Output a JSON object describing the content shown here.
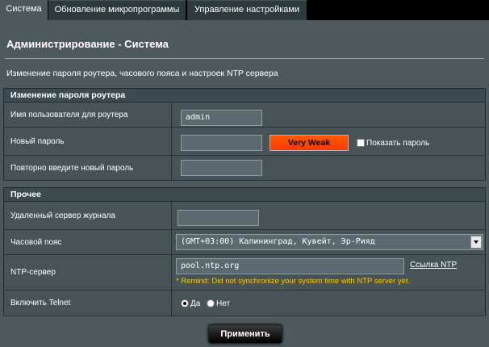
{
  "tabs": [
    {
      "label": "Система",
      "active": true
    },
    {
      "label": "Обновление микропрограммы",
      "active": false
    },
    {
      "label": "Управление настройками",
      "active": false
    }
  ],
  "page": {
    "title": "Администрирование - Система",
    "description": "Изменение пароля роутера, часового пояса и настроек NTP сервера"
  },
  "password_section": {
    "heading": "Изменение пароля роутера",
    "username_label": "Имя пользователя для роутера",
    "username_value": "admin",
    "new_password_label": "Новый пароль",
    "new_password_value": "",
    "strength_text": "Very Weak",
    "show_password_label": "Показать пароль",
    "show_password_checked": false,
    "confirm_label": "Повторно введите новый пароль",
    "confirm_value": ""
  },
  "misc_section": {
    "heading": "Прочее",
    "log_server_label": "Удаленный сервер журнала",
    "log_server_value": "",
    "timezone_label": "Часовой пояс",
    "timezone_value": "(GMT+03:00) Калининград, Кувейт, Эр-Рияд",
    "ntp_label": "NTP-сервер",
    "ntp_value": "pool.ntp.org",
    "ntp_link": "Ссылка NTP",
    "ntp_remind": "* Remind: Did not synchronize your system time with NTP server yet.",
    "telnet_label": "Включить Telnet",
    "telnet_yes": "Да",
    "telnet_no": "Нет",
    "telnet_selected": "yes"
  },
  "apply_label": "Применить",
  "colors": {
    "accent_warning": "#ffcc00",
    "strength_bar": "#ff4a00",
    "background": "#4d595d"
  }
}
